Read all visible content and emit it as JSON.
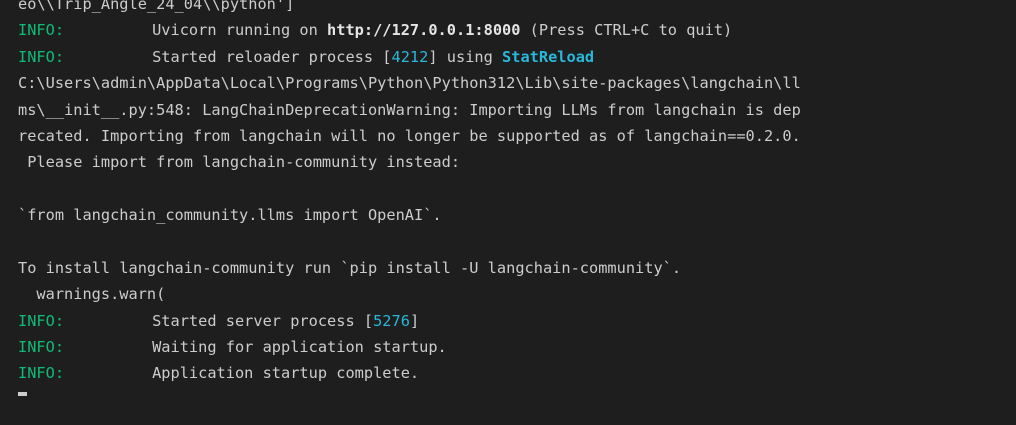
{
  "terminal": {
    "top_partial": "eo\\\\Trip_Angle_24_04\\\\python']",
    "tag": "INFO:",
    "uvicorn": {
      "pre": "Uvicorn running on ",
      "url": "http://127.0.0.1:8000",
      "post": " (Press CTRL+C to quit)"
    },
    "reloader": {
      "pre": "Started reloader process [",
      "pid": "4212",
      "mid": "] using ",
      "tool": "StatReload"
    },
    "warning_lines": [
      "C:\\Users\\admin\\AppData\\Local\\Programs\\Python\\Python312\\Lib\\site-packages\\langchain\\ll",
      "ms\\__init__.py:548: LangChainDeprecationWarning: Importing LLMs from langchain is dep",
      "recated. Importing from langchain will no longer be supported as of langchain==0.2.0.",
      " Please import from langchain-community instead:"
    ],
    "code_line": "`from langchain_community.llms import OpenAI`.",
    "install_line": "To install langchain-community run `pip install -U langchain-community`.",
    "warn_call": "  warnings.warn(",
    "server": {
      "pre": "Started server process [",
      "pid": "5276",
      "post": "]"
    },
    "waiting": "Waiting for application startup.",
    "complete": "Application startup complete."
  },
  "colors": {
    "background": "#1e1e1e",
    "text": "#cccccc",
    "info": "#0dbc79",
    "accent": "#29b8db"
  }
}
